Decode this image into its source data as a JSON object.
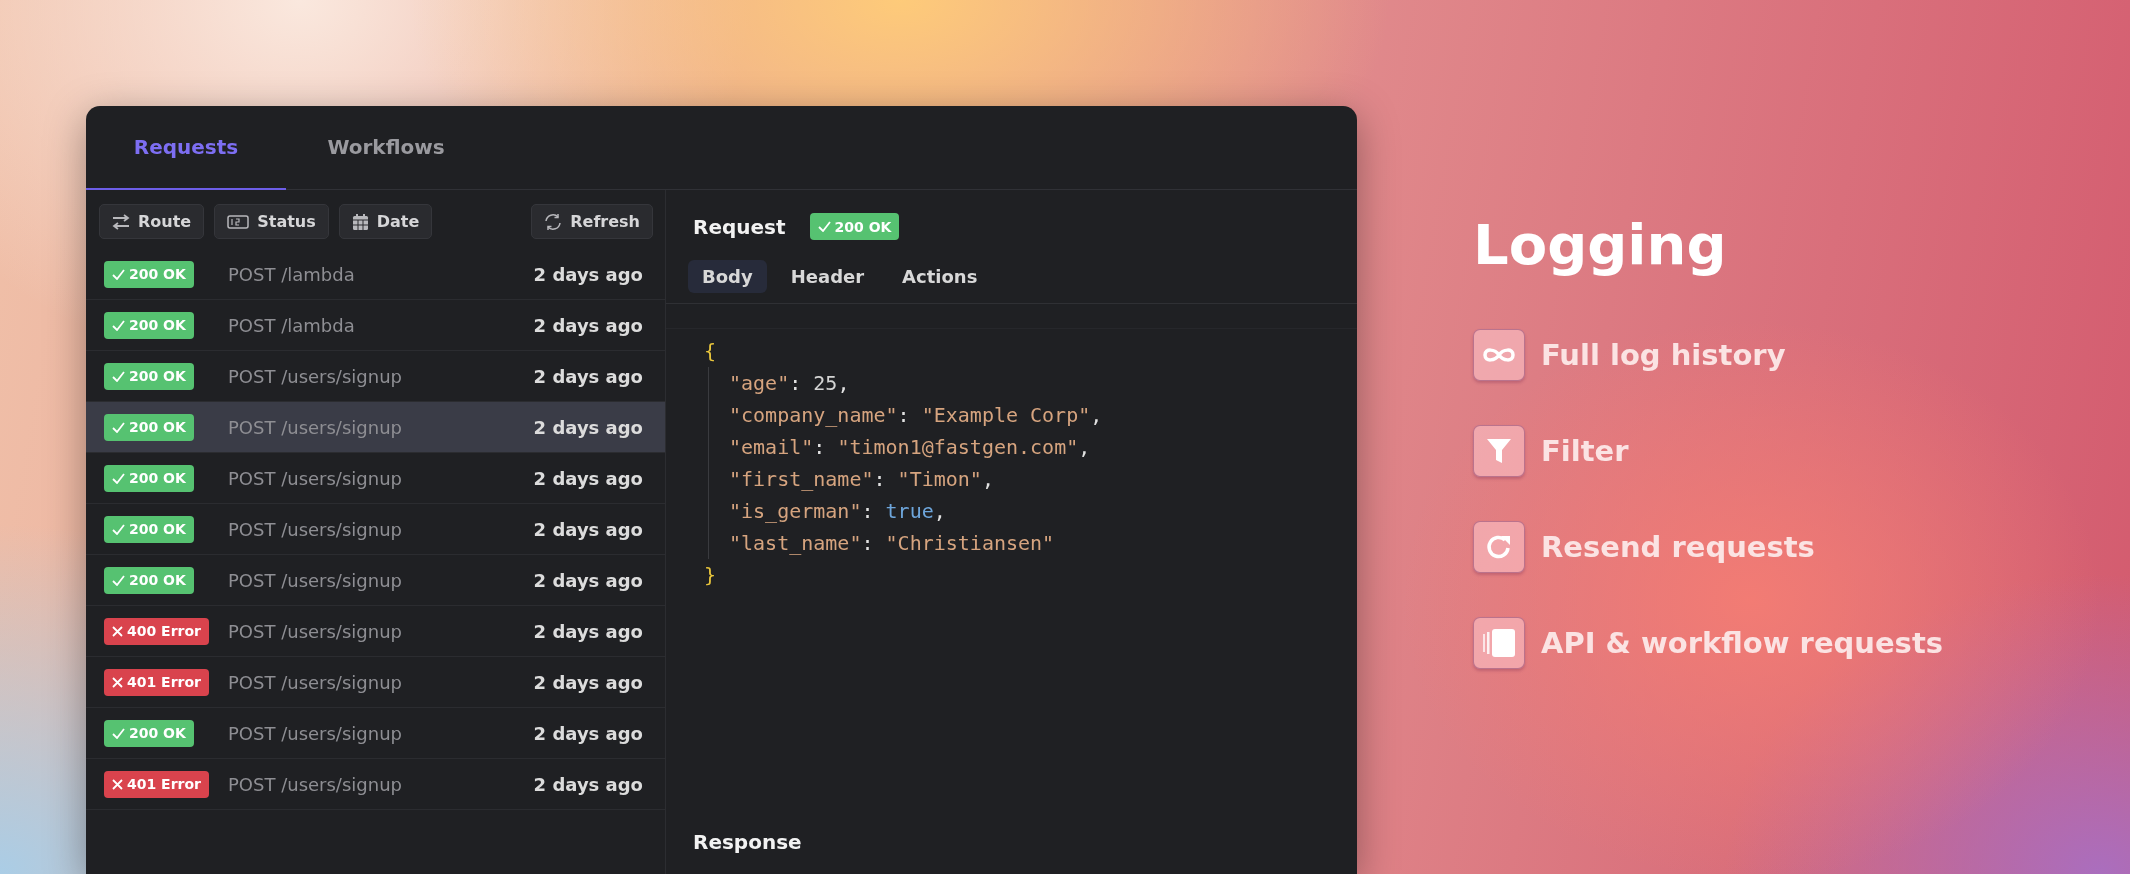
{
  "tabs": [
    {
      "label": "Requests",
      "selected": true
    },
    {
      "label": "Workflows",
      "selected": false
    }
  ],
  "filters": [
    {
      "label": "Route",
      "kind": "swap"
    },
    {
      "label": "Status",
      "kind": "number"
    },
    {
      "label": "Date",
      "kind": "calendar"
    }
  ],
  "refresh": {
    "label": "Refresh"
  },
  "rows": [
    {
      "status": "200 OK",
      "kind": "ok",
      "route": "POST /lambda",
      "time": "2 days ago",
      "selected": false
    },
    {
      "status": "200 OK",
      "kind": "ok",
      "route": "POST /lambda",
      "time": "2 days ago",
      "selected": false
    },
    {
      "status": "200 OK",
      "kind": "ok",
      "route": "POST /users/signup",
      "time": "2 days ago",
      "selected": false
    },
    {
      "status": "200 OK",
      "kind": "ok",
      "route": "POST /users/signup",
      "time": "2 days ago",
      "selected": true
    },
    {
      "status": "200 OK",
      "kind": "ok",
      "route": "POST /users/signup",
      "time": "2 days ago",
      "selected": false
    },
    {
      "status": "200 OK",
      "kind": "ok",
      "route": "POST /users/signup",
      "time": "2 days ago",
      "selected": false
    },
    {
      "status": "200 OK",
      "kind": "ok",
      "route": "POST /users/signup",
      "time": "2 days ago",
      "selected": false
    },
    {
      "status": "400 Error",
      "kind": "error",
      "route": "POST /users/signup",
      "time": "2 days ago",
      "selected": false
    },
    {
      "status": "401 Error",
      "kind": "error",
      "route": "POST /users/signup",
      "time": "2 days ago",
      "selected": false
    },
    {
      "status": "200 OK",
      "kind": "ok",
      "route": "POST /users/signup",
      "time": "2 days ago",
      "selected": false
    },
    {
      "status": "401 Error",
      "kind": "error",
      "route": "POST /users/signup",
      "time": "2 days ago",
      "selected": false
    }
  ],
  "request": {
    "title": "Request",
    "status": "200 OK",
    "kind": "ok"
  },
  "detail_tabs": [
    {
      "label": "Body",
      "selected": true
    },
    {
      "label": "Header",
      "selected": false
    },
    {
      "label": "Actions",
      "selected": false
    }
  ],
  "body": {
    "open": "{",
    "close": "}",
    "lines": [
      [
        {
          "t": "\"age\"",
          "kind": "key"
        },
        {
          "t": ": ",
          "kind": "punct"
        },
        {
          "t": "25",
          "kind": "number"
        },
        {
          "t": ",",
          "kind": "punct"
        }
      ],
      [
        {
          "t": "\"company_name\"",
          "kind": "key"
        },
        {
          "t": ": ",
          "kind": "punct"
        },
        {
          "t": "\"Example Corp\"",
          "kind": "string"
        },
        {
          "t": ",",
          "kind": "punct"
        }
      ],
      [
        {
          "t": "\"email\"",
          "kind": "key"
        },
        {
          "t": ": ",
          "kind": "punct"
        },
        {
          "t": "\"timon1@fastgen.com\"",
          "kind": "string"
        },
        {
          "t": ",",
          "kind": "punct"
        }
      ],
      [
        {
          "t": "\"first_name\"",
          "kind": "key"
        },
        {
          "t": ": ",
          "kind": "punct"
        },
        {
          "t": "\"Timon\"",
          "kind": "string"
        },
        {
          "t": ",",
          "kind": "punct"
        }
      ],
      [
        {
          "t": "\"is_german\"",
          "kind": "key"
        },
        {
          "t": ": ",
          "kind": "punct"
        },
        {
          "t": "true",
          "kind": "boolean"
        },
        {
          "t": ",",
          "kind": "punct"
        }
      ],
      [
        {
          "t": "\"last_name\"",
          "kind": "key"
        },
        {
          "t": ": ",
          "kind": "punct"
        },
        {
          "t": "\"Christiansen\"",
          "kind": "string"
        }
      ]
    ]
  },
  "response": {
    "title": "Response"
  },
  "promo": {
    "title": "Logging",
    "features": [
      {
        "label": "Full log history",
        "kind": "infinity"
      },
      {
        "label": "Filter",
        "kind": "filter"
      },
      {
        "label": "Resend requests",
        "kind": "resend"
      },
      {
        "label": "API & workflow requests",
        "kind": "cards"
      }
    ]
  }
}
